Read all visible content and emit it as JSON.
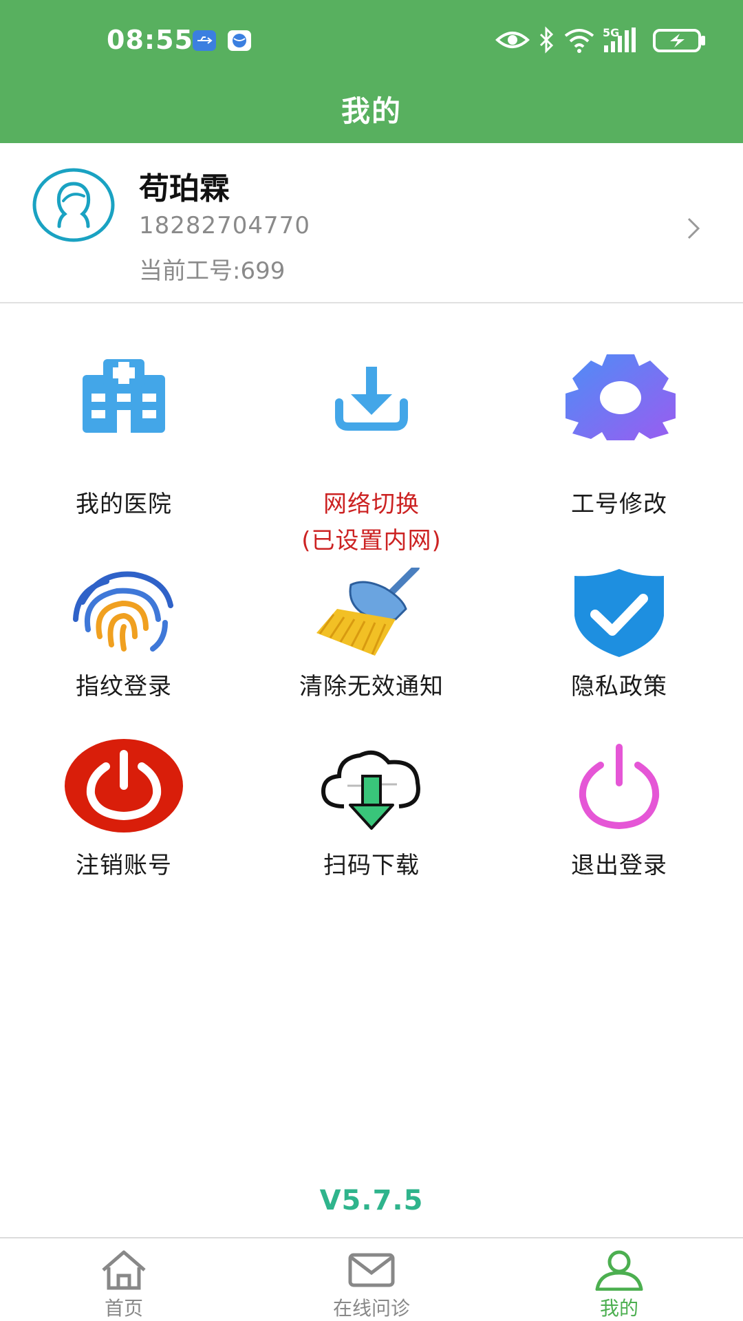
{
  "status_bar": {
    "time": "08:55",
    "network": "5G"
  },
  "header": {
    "title": "我的"
  },
  "profile": {
    "name": "苟珀霖",
    "phone": "18282704770",
    "work_number": "当前工号:699"
  },
  "menu": [
    {
      "label": "我的医院",
      "icon": "hospital-icon"
    },
    {
      "label": "网络切换",
      "sublabel": "(已设置内网)",
      "icon": "download-icon",
      "highlight_color": "#cc2222"
    },
    {
      "label": "工号修改",
      "icon": "gear-icon"
    },
    {
      "label": "指纹登录",
      "icon": "fingerprint-icon"
    },
    {
      "label": "清除无效通知",
      "icon": "broom-icon"
    },
    {
      "label": "隐私政策",
      "icon": "shield-check-icon"
    },
    {
      "label": "注销账号",
      "icon": "power-red-icon"
    },
    {
      "label": "扫码下载",
      "icon": "cloud-download-icon"
    },
    {
      "label": "退出登录",
      "icon": "power-pink-icon"
    }
  ],
  "version": "V5.7.5",
  "bottom_nav": [
    {
      "label": "首页",
      "icon": "home-icon"
    },
    {
      "label": "在线问诊",
      "icon": "mail-icon"
    },
    {
      "label": "我的",
      "icon": "user-icon",
      "active": true
    }
  ],
  "colors": {
    "header_green": "#58b05f",
    "version_teal": "#2fb48c",
    "active_tab": "#4caf50"
  }
}
